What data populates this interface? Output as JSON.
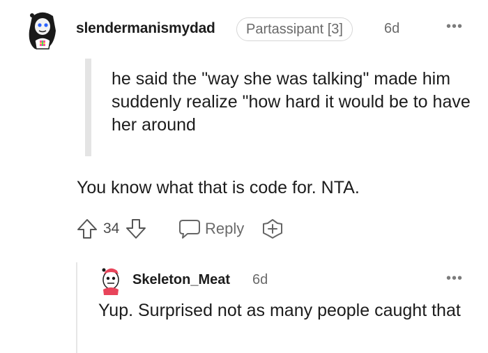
{
  "comment": {
    "author": "slendermanismydad",
    "flair": "Partassipant [3]",
    "age": "6d",
    "more_label": "•••",
    "quote": "he said the \"way she was talking\" made him suddenly realize \"how hard it would be to have her around",
    "body": "You know what that is code for. NTA.",
    "score": "34",
    "reply_label": "Reply"
  },
  "reply": {
    "author": "Skeleton_Meat",
    "age": "6d",
    "more_label": "•••",
    "body": "Yup. Surprised not as many people caught that"
  },
  "colors": {
    "text": "#1c1c1c",
    "meta": "#6a6a6a",
    "quote_bar": "#e4e4e4"
  },
  "icons": [
    "avatar",
    "upvote-icon",
    "downvote-icon",
    "comment-icon",
    "award-icon",
    "more-icon"
  ]
}
